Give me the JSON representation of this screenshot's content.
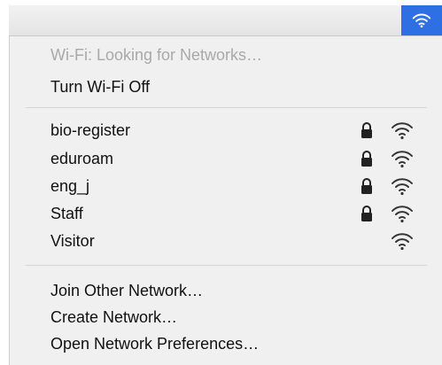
{
  "status": {
    "text": "Wi-Fi: Looking for Networks…"
  },
  "actions": {
    "toggle": "Turn Wi-Fi Off",
    "join_other": "Join Other Network…",
    "create": "Create Network…",
    "preferences": "Open Network Preferences…"
  },
  "networks": [
    {
      "name": "bio-register",
      "locked": true,
      "icon": "wifi-signal-icon"
    },
    {
      "name": "eduroam",
      "locked": true,
      "icon": "wifi-signal-icon"
    },
    {
      "name": "eng_j",
      "locked": true,
      "icon": "wifi-signal-icon"
    },
    {
      "name": "Staff",
      "locked": true,
      "icon": "wifi-signal-icon"
    },
    {
      "name": "Visitor",
      "locked": false,
      "icon": "wifi-signal-icon"
    }
  ],
  "colors": {
    "accent": "#2f6fe4",
    "menu_bg": "#f0f0f0",
    "disabled_text": "#a9a9a9"
  }
}
